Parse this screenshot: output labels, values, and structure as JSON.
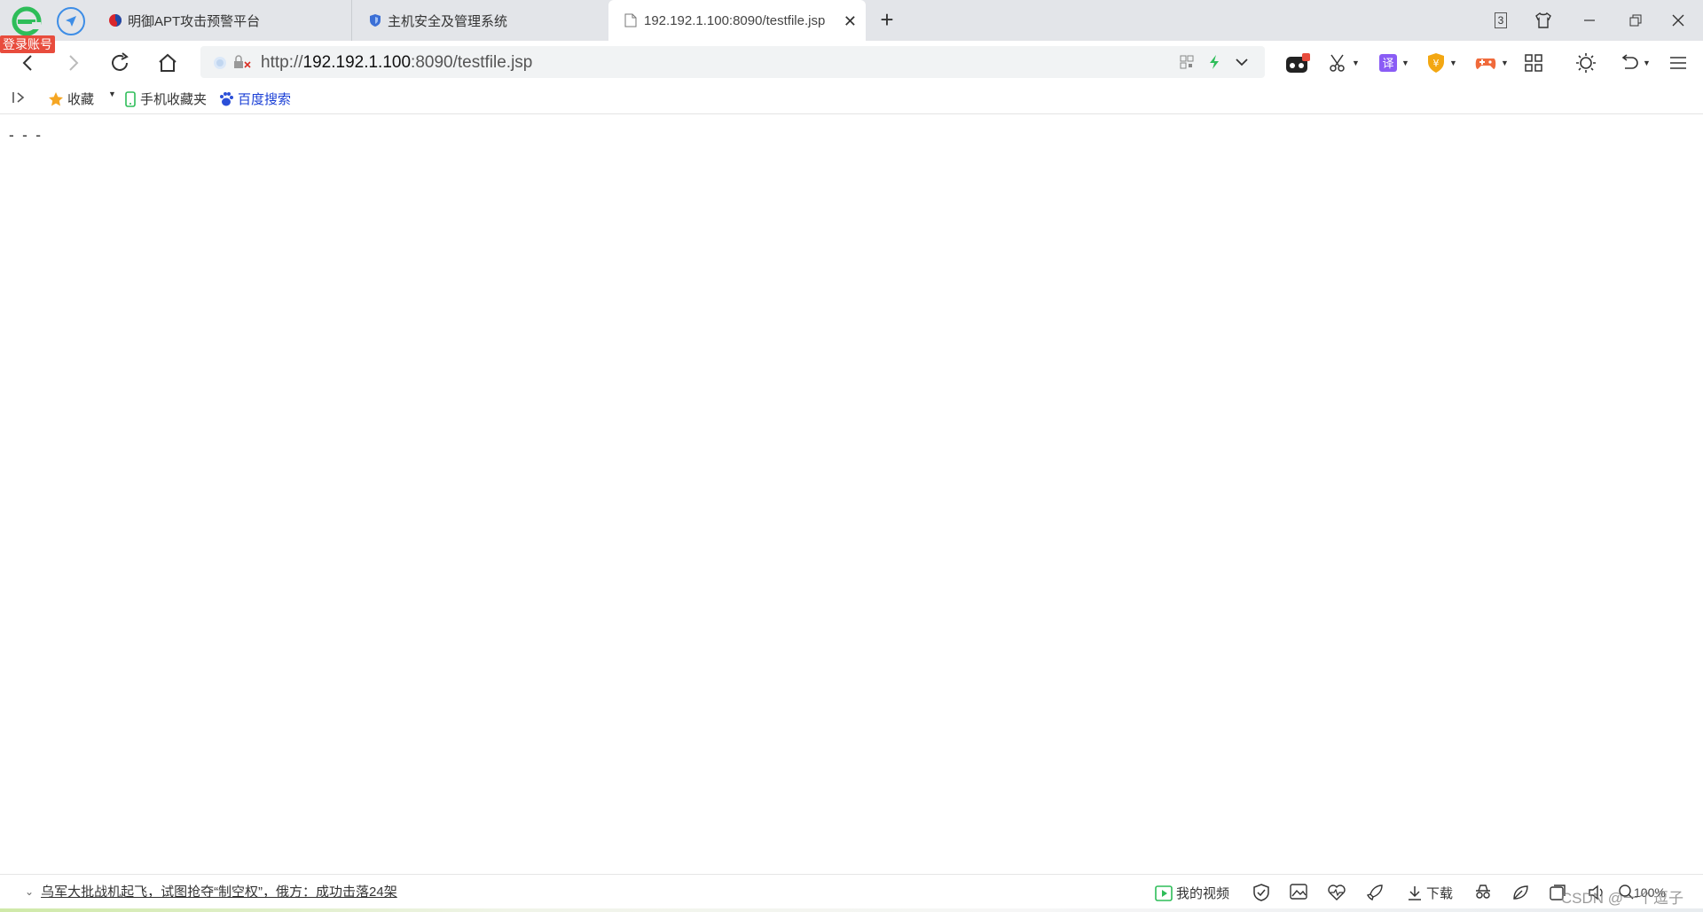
{
  "login_badge": "登录账号",
  "tabs": [
    {
      "title": "明御APT攻击预警平台",
      "icon": "apt-platform-icon",
      "active": false
    },
    {
      "title": "主机安全及管理系统",
      "icon": "shield-icon",
      "active": false
    },
    {
      "title": "192.192.1.100:8090/testfile.jsp",
      "icon": "file-icon",
      "active": true
    }
  ],
  "tab_counter": "3",
  "address": {
    "prefix": "http://",
    "host": "192.192.1.100",
    "rest": ":8090/testfile.jsp"
  },
  "bookmarks": {
    "favorites": "收藏",
    "mobile": "手机收藏夹",
    "baidu": "百度搜索"
  },
  "page_content": "- - -",
  "status": {
    "news": "乌军大批战机起飞，试图抢夺“制空权”，俄方：成功击落24架",
    "video": "我的视频",
    "download": "下载",
    "zoom": "100%",
    "watermark": "CSDN @一个逗子"
  },
  "colors": {
    "accent_green": "#2ebd59",
    "badge_red": "#e84c3d",
    "link_blue": "#1a3fd6"
  }
}
